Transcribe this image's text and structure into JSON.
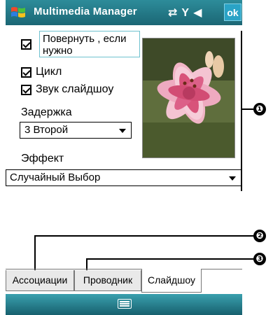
{
  "titlebar": {
    "app_title": "Multimedia Manager",
    "ok_label": "ok",
    "icons": [
      "start-menu-icon",
      "connectivity-icon",
      "signal-icon",
      "volume-icon"
    ]
  },
  "slideshow": {
    "rotate_label": "Повернуть , если нужно",
    "rotate_checked": true,
    "loop_label": "Цикл",
    "loop_checked": true,
    "sound_label": "Звук слайдшоу",
    "sound_checked": true,
    "delay_label": "Задержка",
    "delay_value": "3 Второй",
    "effect_label": "Эффект",
    "effect_value": "Случайный Выбор"
  },
  "callouts": [
    "❶",
    "❷",
    "❸"
  ],
  "tabs": [
    {
      "label": "Ассоциации",
      "active": false
    },
    {
      "label": "Проводник",
      "active": false
    },
    {
      "label": "Слайдшоу",
      "active": true
    }
  ],
  "colors": {
    "titlebar": "#1b6674",
    "ok_button": "#2aa3c6",
    "selection_border": "#6fc1cf"
  }
}
